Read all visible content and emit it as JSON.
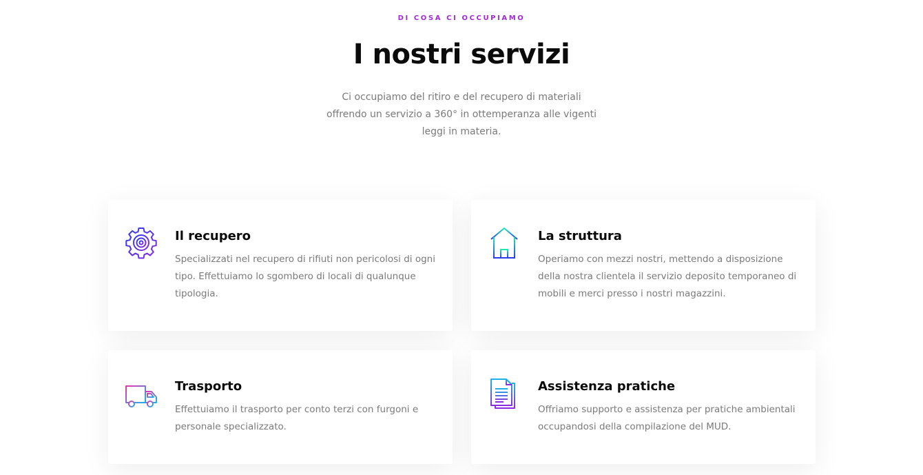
{
  "header": {
    "eyebrow": "DI COSA CI OCCUPIAMO",
    "title": "I nostri servizi",
    "intro": "Ci occupiamo del ritiro e del recupero di materiali offrendo un servizio a 360° in ottemperanza alle vigenti leggi in materia."
  },
  "colors": {
    "accent": "#a12ad8",
    "heading": "#0b0b0b",
    "body_text": "#7a7a7a",
    "icon_gradient_blue": "#2b3bf0",
    "icon_gradient_violet": "#8a2be2",
    "icon_gradient_teal": "#1de9b6",
    "icon_gradient_pink": "#e535ab"
  },
  "services": [
    {
      "icon": "gear-icon",
      "title": "Il recupero",
      "description": "Specializzati nel recupero di rifiuti non pericolosi di ogni tipo. Effettuiamo lo sgombero di locali di qualunque tipologia."
    },
    {
      "icon": "house-icon",
      "title": "La struttura",
      "description": "Operiamo con mezzi nostri, mettendo a disposizione della nostra clientela il servizio deposito temporaneo di mobili e merci presso i nostri magazzini."
    },
    {
      "icon": "truck-icon",
      "title": "Trasporto",
      "description": "Effettuiamo il trasporto per conto terzi con furgoni e personale specializzato."
    },
    {
      "icon": "document-icon",
      "title": "Assistenza pratiche",
      "description": "Offriamo supporto e assistenza per pratiche ambientali occupandosi della compilazione del MUD."
    }
  ]
}
